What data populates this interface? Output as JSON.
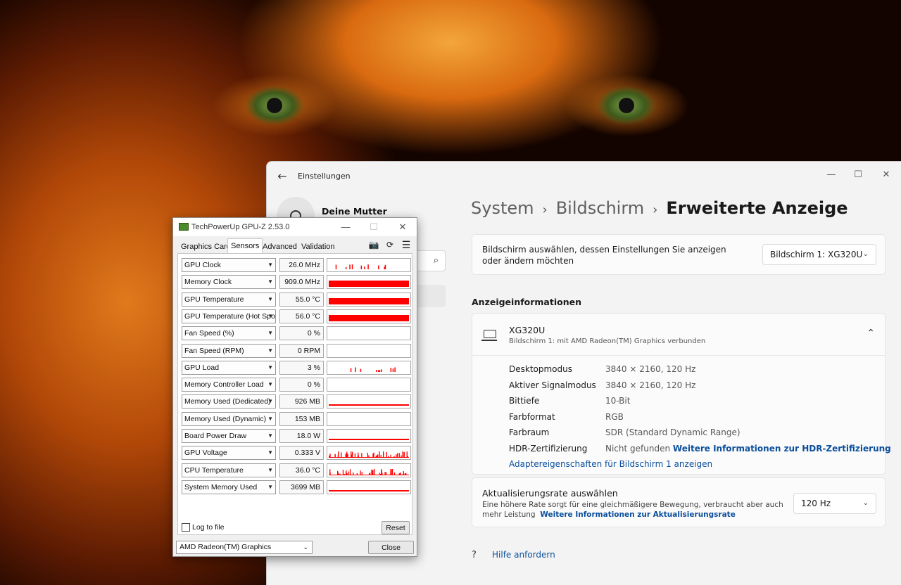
{
  "settings": {
    "window_title": "Einstellungen",
    "user_name": "Deine Mutter",
    "breadcrumb": [
      "System",
      "Bildschirm",
      "Erweiterte Anzeige"
    ],
    "display_select": {
      "label": "Bildschirm auswählen, dessen Einstellungen Sie anzeigen oder ändern möchten",
      "value": "Bildschirm 1: XG320U"
    },
    "section_title": "Anzeigeinformationen",
    "display_info": {
      "name": "XG320U",
      "subtitle": "Bildschirm 1: mit AMD Radeon(TM) Graphics verbunden",
      "rows": [
        {
          "label": "Desktopmodus",
          "value": "3840 × 2160, 120 Hz"
        },
        {
          "label": "Aktiver Signalmodus",
          "value": "3840 × 2160, 120 Hz"
        },
        {
          "label": "Bittiefe",
          "value": "10-Bit"
        },
        {
          "label": "Farbformat",
          "value": "RGB"
        },
        {
          "label": "Farbraum",
          "value": "SDR (Standard Dynamic Range)"
        },
        {
          "label": "HDR-Zertifizierung",
          "value": "Nicht gefunden",
          "link": "Weitere Informationen zur HDR-Zertifizierung"
        }
      ],
      "adapter_link": "Adaptereigenschaften für Bildschirm 1 anzeigen"
    },
    "refresh": {
      "title": "Aktualisierungsrate auswählen",
      "desc": "Eine höhere Rate sorgt für eine gleichmäßigere Bewegung, verbraucht aber auch mehr Leistung",
      "link": "Weitere Informationen zur Aktualisierungsrate",
      "value": "120 Hz"
    },
    "help": "Hilfe anfordern",
    "icons": {
      "back": "back-arrow-icon",
      "minimize": "minimize-icon",
      "maximize": "maximize-icon",
      "close": "close-icon",
      "search": "search-icon",
      "help": "help-icon"
    }
  },
  "gpuz": {
    "title": "TechPowerUp GPU-Z 2.53.0",
    "tabs": [
      "Graphics Card",
      "Sensors",
      "Advanced",
      "Validation"
    ],
    "active_tab": "Sensors",
    "sensors": [
      {
        "name": "GPU Clock",
        "value": "26.0 MHz",
        "graph": "spikes"
      },
      {
        "name": "Memory Clock",
        "value": "909.0 MHz",
        "graph": "full"
      },
      {
        "name": "GPU Temperature",
        "value": "55.0 °C",
        "graph": "full"
      },
      {
        "name": "GPU Temperature (Hot Spot)",
        "value": "56.0 °C",
        "graph": "full"
      },
      {
        "name": "Fan Speed (%)",
        "value": "0 %",
        "graph": "none"
      },
      {
        "name": "Fan Speed (RPM)",
        "value": "0 RPM",
        "graph": "none"
      },
      {
        "name": "GPU Load",
        "value": "3 %",
        "graph": "spikes"
      },
      {
        "name": "Memory Controller Load",
        "value": "0 %",
        "graph": "none"
      },
      {
        "name": "Memory Used (Dedicated)",
        "value": "926 MB",
        "graph": "line"
      },
      {
        "name": "Memory Used (Dynamic)",
        "value": "153 MB",
        "graph": "none"
      },
      {
        "name": "Board Power Draw",
        "value": "18.0 W",
        "graph": "line"
      },
      {
        "name": "GPU Voltage",
        "value": "0.333 V",
        "graph": "dense"
      },
      {
        "name": "CPU Temperature",
        "value": "36.0 °C",
        "graph": "dense"
      },
      {
        "name": "System Memory Used",
        "value": "3699 MB",
        "graph": "line"
      }
    ],
    "log_to_file": "Log to file",
    "reset": "Reset",
    "gpu_select": "AMD Radeon(TM) Graphics",
    "close": "Close",
    "graph_color": "#ff0000"
  }
}
